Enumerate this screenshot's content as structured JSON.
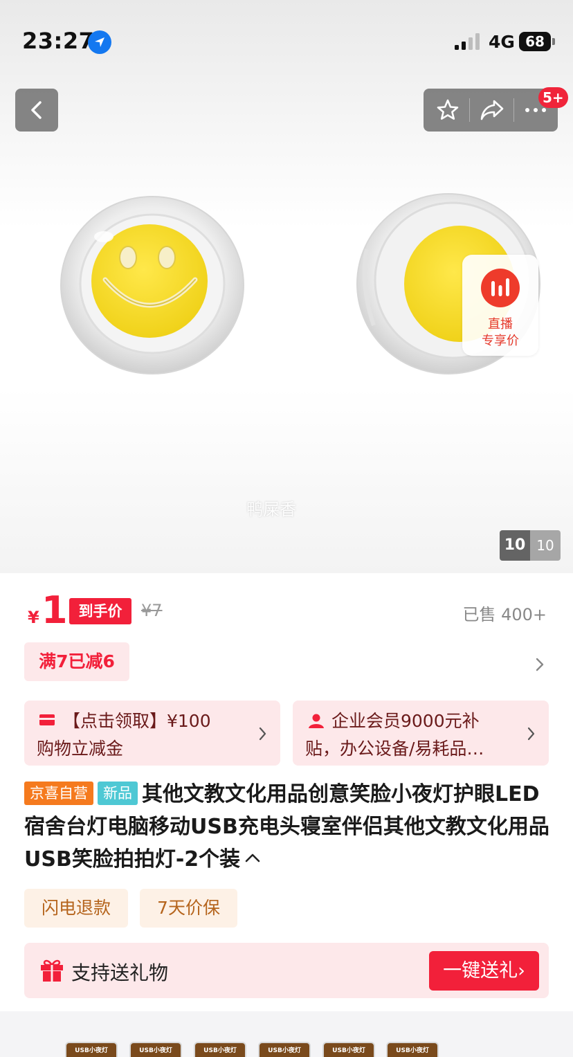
{
  "status_bar": {
    "time": "23:27",
    "network": "4G",
    "battery": "68"
  },
  "nav": {
    "back_icon": "chevron-left-icon",
    "actions": [
      "star-icon",
      "share-icon",
      "more-icon"
    ],
    "notification_badge": "5+"
  },
  "hero": {
    "live_badge": {
      "line1": "直播",
      "line2": "专享价"
    },
    "watermark": "鸭屎香",
    "image_counter": {
      "current": "10",
      "total": "10"
    }
  },
  "price": {
    "symbol": "¥",
    "value": "1",
    "tag": "到手价",
    "original": "¥7",
    "sold": "已售 400+"
  },
  "discount": {
    "label": "满7已减6"
  },
  "promos": [
    {
      "icon": "card-icon",
      "line1": "【点击领取】¥100",
      "line2": "购物立减金"
    },
    {
      "icon": "user-icon",
      "line1": "企业会员9000元补",
      "line2": "贴，办公设备/易耗品…"
    }
  ],
  "product": {
    "tags": [
      "京喜自营",
      "新品"
    ],
    "title": "其他文教文化用品创意笑脸小夜灯护眼LED宿舍台灯电脑移动USB充电头寝室伴侣其他文教文化用品 USB笑脸拍拍灯-2个装"
  },
  "services": [
    "闪电退款",
    "7天价保"
  ],
  "gift": {
    "label": "支持送礼物",
    "button": "一键送礼›"
  },
  "thumbnails": [
    {
      "label": "USB小夜灯"
    },
    {
      "label": "USB小夜灯"
    },
    {
      "label": "USB小夜灯"
    },
    {
      "label": "USB小夜灯"
    },
    {
      "label": "USB小夜灯"
    },
    {
      "label": "USB小夜灯"
    }
  ],
  "colors": {
    "accent_red": "#f2203a",
    "jd_orange": "#f57a1e",
    "new_teal": "#4ec8d4",
    "pink_bg": "#fde8ea",
    "service_bg": "#fdf1e6"
  }
}
